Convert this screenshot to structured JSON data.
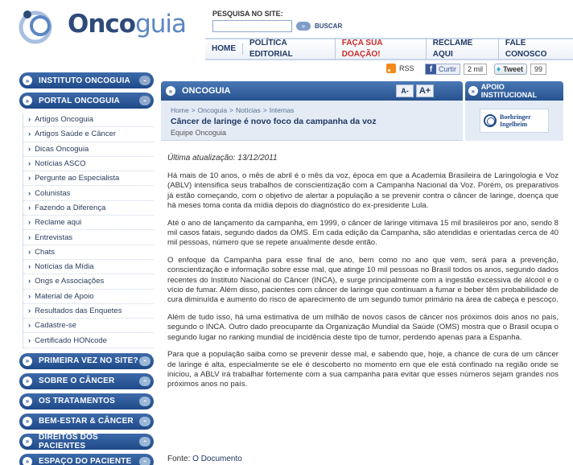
{
  "brand": {
    "name_bold": "Onco",
    "name_light": "guia"
  },
  "search": {
    "label": "PESQUISA NO SITE:",
    "value": "",
    "placeholder": "",
    "button_label": "BUSCAR"
  },
  "topnav": [
    "HOME",
    "POLÍTICA EDITORIAL",
    "FAÇA SUA DOAÇÃO!",
    "RECLAME AQUI",
    "FALE CONOSCO"
  ],
  "social": {
    "rss_label": "RSS",
    "facebook": {
      "label": "Curtir",
      "count": "2 mil"
    },
    "twitter": {
      "label": "Tweet",
      "count": "99"
    }
  },
  "sidebar": {
    "sections": [
      {
        "label": "INSTITUTO ONCOGUIA",
        "toggle": "-"
      },
      {
        "label": "PORTAL ONCOGUIA",
        "toggle": "-"
      },
      {
        "label": "PRIMEIRA VEZ NO SITE?",
        "toggle": "-"
      },
      {
        "label": "SOBRE O CÂNCER",
        "toggle": "-"
      },
      {
        "label": "OS TRATAMENTOS",
        "toggle": "-"
      },
      {
        "label": "BEM-ESTAR & CÂNCER",
        "toggle": "-"
      },
      {
        "label": "DIREITOS DOS PACIENTES",
        "toggle": "-"
      },
      {
        "label": "ESPAÇO DO PACIENTE",
        "toggle": "-"
      }
    ],
    "portal_items": [
      "Artigos Oncoguia",
      "Artigos Saúde e Câncer",
      "Dicas Oncoguia",
      "Notícias ASCO",
      "Pergunte ao Especialista",
      "Colunistas",
      "Fazendo a Diferença",
      "Reclame aqui",
      "Entrevistas",
      "Chats",
      "Notícias da Mídia",
      "Ongs e Associações",
      "Material de Apoio",
      "Resultados das Enquetes",
      "Cadastre-se",
      "Certificado HONcode"
    ]
  },
  "panel": {
    "title": "ONCOGUIA",
    "font_smaller": "A-",
    "font_bigger": "A+",
    "breadcrumb": [
      "Home",
      "Oncoguia",
      "Notícias",
      "Internas"
    ],
    "article_title": "Câncer de laringe é novo foco da campanha da voz",
    "author": "Equipe Oncoguia"
  },
  "sponsor": {
    "title": "APOIO INSTITUCIONAL",
    "logo_line1": "Boehringer",
    "logo_line2": "Ingelheim"
  },
  "article": {
    "updated": "Última atualização: 13/12/2011",
    "paragraphs": [
      "Há mais de 10 anos, o mês de abril é o mês da voz, época em que a Academia Brasileira de Laringologia e Voz (ABLV) intensifica seus trabalhos de conscientização com a Campanha Nacional da Voz. Porém, os preparativos já estão começando, com o objetivo de alertar a população a se prevenir contra o câncer de laringe, doença que há meses toma conta da mídia depois do diagnóstico do ex-presidente Lula.",
      "Até o ano de lançamento da campanha, em 1999, o câncer de laringe vitimava 15 mil brasileiros por ano, sendo 8 mil casos fatais, segundo dados da OMS. Em cada edição da Campanha, são atendidas e orientadas cerca de 40 mil pessoas, número que se repete anualmente desde então.",
      "O enfoque da Campanha para esse final de ano, bem como no ano que vem, será para a prevenção, conscientização e informação sobre esse mal, que atinge 10 mil pessoas no Brasil todos os anos, segundo dados recentes do Instituto Nacional do Câncer (INCA), e surge principalmente com a ingestão excessiva de álcool e o vício de fumar. Além disso, pacientes com câncer de laringe que continuam a fumar e beber têm probabilidade de cura diminuída e aumento do risco de aparecimento de um segundo tumor primário na área de cabeça e pescoço.",
      "Além de tudo isso, há uma estimativa de um milhão de novos casos de câncer nos próximos dois anos no país, segundo o INCA. Outro dado preocupante da Organização Mundial da Saúde (OMS) mostra que o Brasil ocupa o segundo lugar no ranking mundial de incidência deste tipo de tumor, perdendo apenas para a Espanha.",
      "Para que a população saiba como se prevenir desse mal, e sabendo que, hoje, a chance de cura de um câncer de laringe é alta, especialmente se ele é descoberto no momento em que ele está confinado na região onde se iniciou, a ABLV irá trabalhar fortemente com a sua campanha para evitar que esses números sejam grandes nos próximos anos no país."
    ],
    "source_label": "Fonte:",
    "source_link": "O Documento"
  }
}
